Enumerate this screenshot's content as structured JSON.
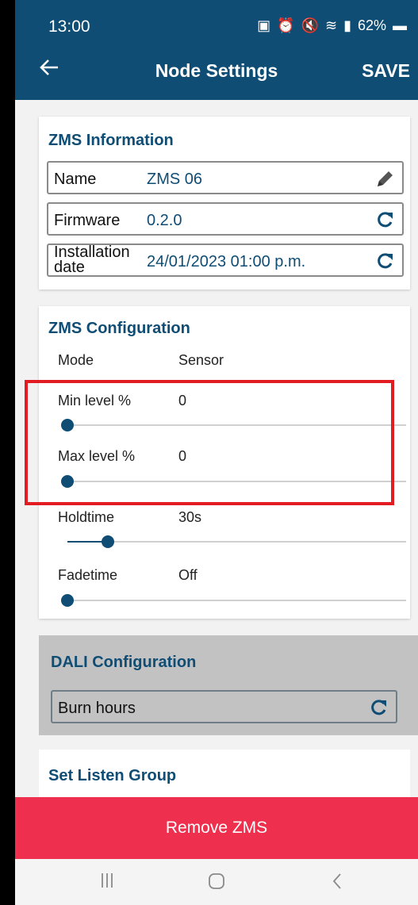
{
  "status_bar": {
    "time": "13:00",
    "battery": "62%",
    "icons": [
      "photo-icon",
      "alarm-icon",
      "mute-icon",
      "wifi-icon",
      "volte-icon",
      "signal-icon",
      "battery-icon"
    ]
  },
  "header": {
    "title": "Node Settings",
    "save_label": "SAVE",
    "back_icon": "back-arrow-icon"
  },
  "zms_information": {
    "title": "ZMS Information",
    "rows": [
      {
        "label": "Name",
        "value": "ZMS 06",
        "action_icon": "edit-pencil-icon"
      },
      {
        "label": "Firmware",
        "value": "0.2.0",
        "action_icon": "refresh-icon"
      },
      {
        "label": "Installation date",
        "value": "24/01/2023 01:00 p.m.",
        "action_icon": "refresh-icon"
      }
    ]
  },
  "zms_configuration": {
    "title": "ZMS Configuration",
    "mode": {
      "label": "Mode",
      "value": "Sensor"
    },
    "sliders": [
      {
        "label": "Min level %",
        "value": "0",
        "fraction": 0
      },
      {
        "label": "Max level %",
        "value": "0",
        "fraction": 0
      },
      {
        "label": "Holdtime",
        "value": "30s",
        "fraction": 0.12
      },
      {
        "label": "Fadetime",
        "value": "Off",
        "fraction": 0
      }
    ]
  },
  "dali_configuration": {
    "title": "DALI Configuration",
    "row_label": "Burn hours",
    "action_icon": "refresh-icon"
  },
  "set_listen_group": {
    "title": "Set Listen Group"
  },
  "remove_button": {
    "label": "Remove ZMS"
  },
  "nav_bar": {
    "items": [
      "recent-apps-icon",
      "home-icon",
      "back-icon"
    ]
  },
  "colors": {
    "primary": "#0f4d75",
    "danger": "#ee2f4d",
    "highlight": "#e31b23",
    "disabled_card": "#c2c2c2"
  }
}
